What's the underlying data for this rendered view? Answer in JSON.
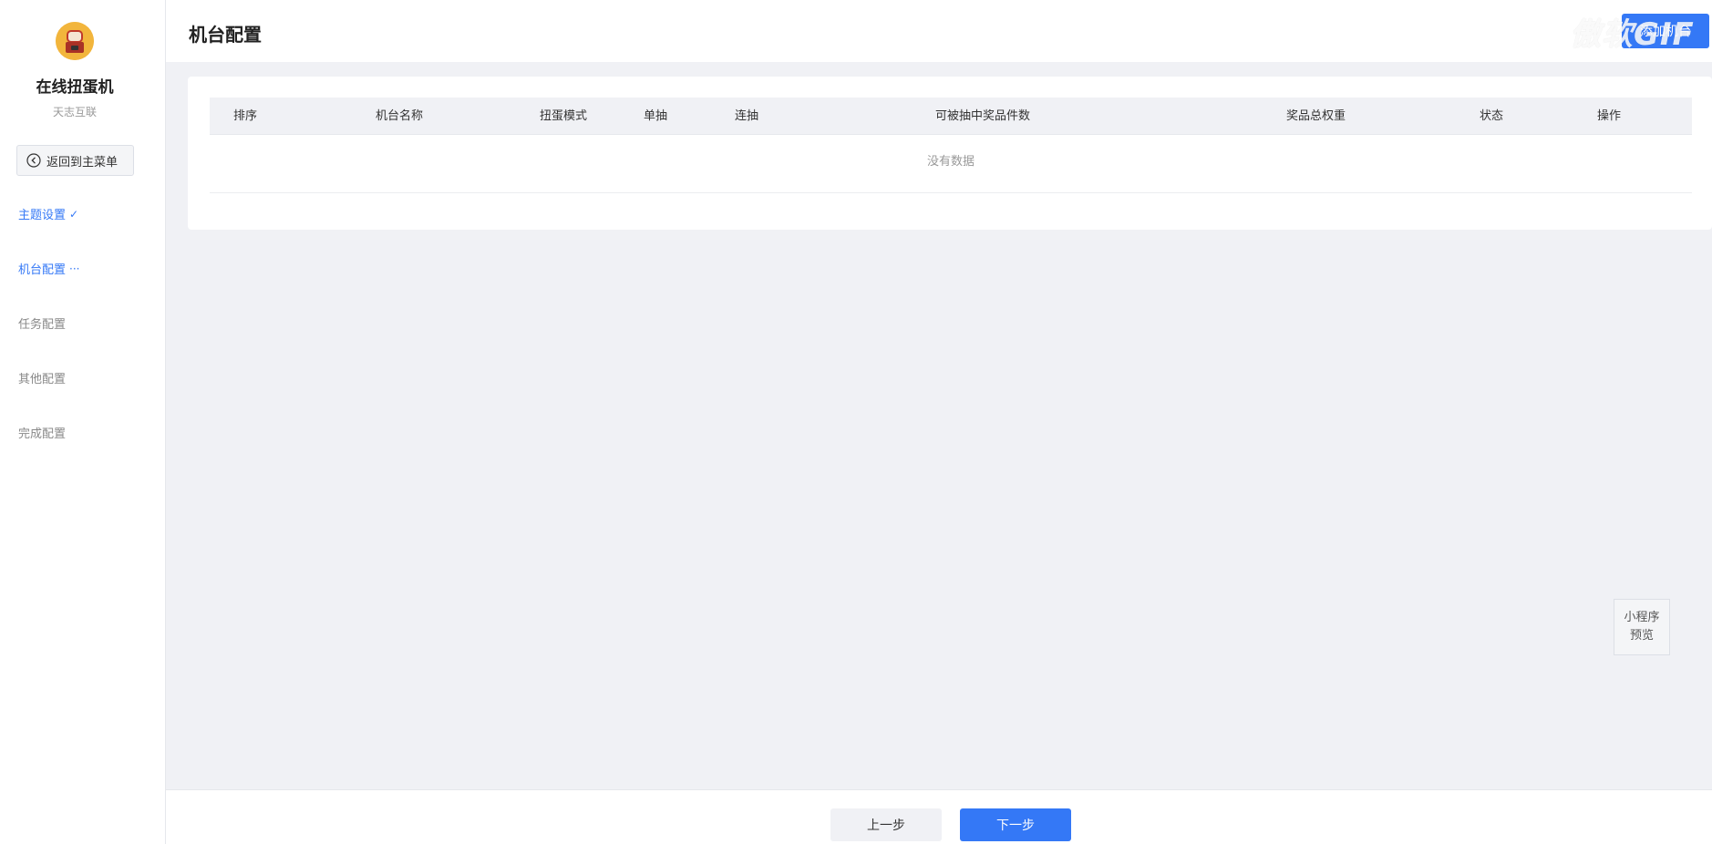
{
  "sidebar": {
    "app_name": "在线扭蛋机",
    "company": "天志互联",
    "back_label": "返回到主菜单",
    "items": [
      {
        "label": "主题设置",
        "mark": "✓",
        "active": true
      },
      {
        "label": "机台配置",
        "mark": "···",
        "active": true
      },
      {
        "label": "任务配置",
        "mark": "",
        "active": false
      },
      {
        "label": "其他配置",
        "mark": "",
        "active": false
      },
      {
        "label": "完成配置",
        "mark": "",
        "active": false
      }
    ]
  },
  "header": {
    "title": "机台配置",
    "button_label": "添加机台",
    "watermark": "傲软GIF"
  },
  "table": {
    "columns": [
      "排序",
      "机台名称",
      "扭蛋模式",
      "单抽",
      "连抽",
      "可被抽中奖品件数",
      "奖品总权重",
      "状态",
      "操作"
    ],
    "empty_text": "没有数据"
  },
  "preview": {
    "line1": "小程序",
    "line2": "预览"
  },
  "footer": {
    "prev_label": "上一步",
    "next_label": "下一步"
  },
  "colors": {
    "accent": "#3478f6",
    "background": "#f0f1f5",
    "logo": "#f2b53c"
  }
}
